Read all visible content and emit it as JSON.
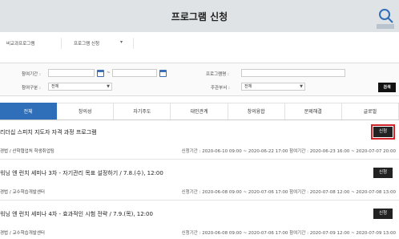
{
  "header": {
    "title": "프로그램 신청"
  },
  "breadcrumb": {
    "item1": "비교과프로그램",
    "item2": "프로그램 신청"
  },
  "search": {
    "period_label": "참여기간 :",
    "period_sep": "~",
    "program_label": "프로그램명 :",
    "type_label": "참여구분 :",
    "type_value": "전체",
    "dept_label": "주관부서 :",
    "dept_value": "전체",
    "search_button": "검색"
  },
  "tabs": [
    {
      "label": "전체"
    },
    {
      "label": "창의성"
    },
    {
      "label": "자기주도"
    },
    {
      "label": "대인관계"
    },
    {
      "label": "창의융합"
    },
    {
      "label": "문제해결"
    },
    {
      "label": "글로벌"
    }
  ],
  "programs": [
    {
      "title": "리더십 스피치 지도자 자격 과정 프로그램",
      "org": "경법 / 산학협업처 학생취업팀",
      "periods": "신청기간 : 2020-06-10 09:00 ~ 2020-06-22 17:00   참여기간 : 2020-06-23 16:00 ~ 2020-07-07 20:00",
      "apply": "신청"
    },
    {
      "title": "워닝 엔 런치 세미나 3차 - 자기관리 목표 설정하기 / 7.8.(수), 12:00",
      "org": "경법 / 교수학습개발센터",
      "periods": "신청기간 : 2020-06-08 09:00 ~ 2020-07-06 17:00   참여기간 : 2020-07-08 12:00 ~ 2020-07-08 13:00",
      "apply": "신청"
    },
    {
      "title": "워닝 엔 런치 세미나 4차 - 효과적인 시험 전략 / 7.9.(목), 12:00",
      "org": "경법 / 교수학습개발센터",
      "periods": "신청기간 : 2020-06-08 09:00 ~ 2020-07-06 17:00   참여기간 : 2020-07-09 12:00 ~ 2020-07-09 13:00",
      "apply": "신청"
    }
  ],
  "colors": {
    "accent": "#2f6fba",
    "highlight": "#d2232a",
    "banner": "#dfe3e6"
  }
}
